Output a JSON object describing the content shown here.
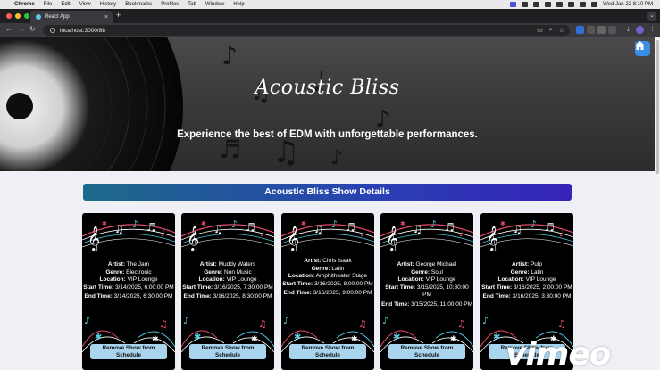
{
  "menubar": {
    "items": [
      "Chrome",
      "File",
      "Edit",
      "View",
      "History",
      "Bookmarks",
      "Profiles",
      "Tab",
      "Window",
      "Help"
    ],
    "datetime": "Wed Jan 22  8:10 PM"
  },
  "browser": {
    "tab_title": "React App",
    "tab_close": "×",
    "new_tab": "+",
    "url": "localhost:3000/88"
  },
  "hero": {
    "title": "Acoustic Bliss",
    "subtitle": "Experience the best of EDM with unforgettable performances."
  },
  "section": {
    "heading": "Acoustic Bliss Show Details"
  },
  "labels": {
    "artist": "Artist:",
    "genre": "Genre:",
    "location": "Location:",
    "start": "Start Time:",
    "end": "End Time:",
    "remove": "Remove Show from Schedule"
  },
  "shows": [
    {
      "artist": "The Jam",
      "genre": "Electronic",
      "location": "VIP Lounge",
      "start": "3/14/2025, 6:00:00 PM",
      "end": "3/14/2025, 6:30:00 PM"
    },
    {
      "artist": "Muddy Waters",
      "genre": "Non Music",
      "location": "VIP Lounge",
      "start": "3/16/2025, 7:30:00 PM",
      "end": "3/16/2025, 8:30:00 PM"
    },
    {
      "artist": "Chris Isaak",
      "genre": "Latin",
      "location": "Amphitheater Stage",
      "start": "3/16/2025, 8:00:00 PM",
      "end": "3/16/2025, 9:00:00 PM"
    },
    {
      "artist": "George Michael",
      "genre": "Soul",
      "location": "VIP Lounge",
      "start": "3/15/2025, 10:30:00 PM",
      "end": "3/15/2025, 11:00:00 PM"
    },
    {
      "artist": "Pulp",
      "genre": "Latin",
      "location": "VIP Lounge",
      "start": "3/16/2025, 2:00:00 PM",
      "end": "3/16/2025, 3:30:00 PM"
    }
  ],
  "watermark": "vimeo",
  "colors": {
    "section_gradient_start": "#1c6b89",
    "section_gradient_end": "#3623b8",
    "button": "#a9d4ee",
    "home_button": "#3a8ee6"
  }
}
